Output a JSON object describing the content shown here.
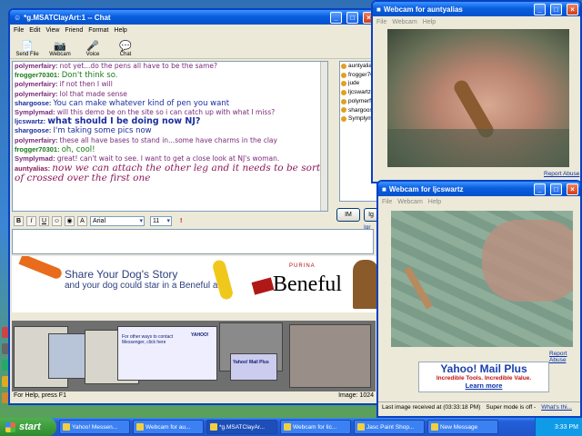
{
  "chat": {
    "title": "*g.MSATClayArt:1 -- Chat",
    "menu": [
      "File",
      "Edit",
      "View",
      "Friend",
      "Format",
      "Help"
    ],
    "toolbar": [
      "Send File",
      "Webcam",
      "Voice",
      "Chat"
    ],
    "messages": [
      {
        "name": "polymerfairy:",
        "text": "not yet...do the pens all have to be the same?",
        "color": "#7a2a7a",
        "size": "normal"
      },
      {
        "name": "frogger70301:",
        "text": "Don't think so.",
        "color": "#1a7a1a",
        "size": "large"
      },
      {
        "name": "polymerfairy:",
        "text": "if not then I will",
        "color": "#7a2a7a",
        "size": "normal"
      },
      {
        "name": "polymerfairy:",
        "text": "lol that made sense",
        "color": "#7a2a7a",
        "size": "normal"
      },
      {
        "name": "shargoose:",
        "text": "You can make whatever kind of pen you want",
        "color": "#1c2e9e",
        "size": "large"
      },
      {
        "name": "Symplymad:",
        "text": "will this demo be on the site so i can catch up with what I miss?",
        "color": "#7a2a7a",
        "size": "normal"
      },
      {
        "name": "ljcswartz:",
        "text": "what should I be doing now NJ?",
        "color": "#1c2e9e",
        "size": "xlarge"
      },
      {
        "name": "shargoose:",
        "text": "I'm taking some pics now",
        "color": "#1c2e9e",
        "size": "large"
      },
      {
        "name": "polymerfairy:",
        "text": "these all have bases to stand in...some have charms in the clay",
        "color": "#7a2a7a",
        "size": "normal"
      },
      {
        "name": "frogger70301:",
        "text": "oh, cool!",
        "color": "#1a7a1a",
        "size": "large"
      },
      {
        "name": "Symplymad:",
        "text": "great! can't wait to see. I want to get a close look at NJ's woman.",
        "color": "#7a2a7a",
        "size": "normal"
      },
      {
        "name": "auntyalias:",
        "text": "now we can attach the other leg and it needs to be sort of crossed over the first one",
        "color": "#8a1a5a",
        "size": "script"
      }
    ],
    "users": [
      "auntyalias",
      "frogger703...",
      "jude",
      "ljcswartz",
      "polymerfairy",
      "shargoos...",
      "Symplymad..."
    ],
    "im_button": "IM",
    "ignore_button": "Ig",
    "ignore_link": "Igr",
    "format": {
      "font": "Arial",
      "size": "11",
      "bold": "B",
      "italic": "I",
      "underline": "U"
    },
    "ad": {
      "line1": "Share Your Dog's Story",
      "line2": "and your dog could star in a Beneful ad!",
      "purina": "PURINA",
      "brand": "Beneful"
    },
    "thumb_text": [
      "For other ways to contact Messenger, click here",
      "Yahoo! Mail Plus",
      "YAHOO!"
    ],
    "status_left": "For Help, press F1",
    "status_right": "Image: 1024"
  },
  "webcam1": {
    "title": "Webcam for auntyalias",
    "menu": [
      "File",
      "Webcam",
      "Help"
    ],
    "report": "Report Abuse"
  },
  "webcam2": {
    "title": "Webcam for ljcswartz",
    "menu": [
      "File",
      "Webcam",
      "Help"
    ],
    "report": "Report Abuse",
    "ad_title": "Yahoo! Mail Plus",
    "ad_sub": "Incredible Tools. Incredible Value.",
    "ad_link": "Learn more",
    "last_image": "Last image received at (03:33:18 PM)",
    "super_mode": "Super mode is off -",
    "whats_this": "What's thi..."
  },
  "taskbar": {
    "start": "start",
    "tasks": [
      "Yahoo! Messen...",
      "Webcam for au...",
      "*g.MSATClayAr...",
      "Webcam for lic...",
      "Jasc Paint Shop...",
      "New Message"
    ],
    "clock": "3:33 PM"
  },
  "colors": {
    "title_blue": "#0a5de0",
    "link_blue": "#0b33aa",
    "yahoo_blue": "#1a3fae"
  }
}
